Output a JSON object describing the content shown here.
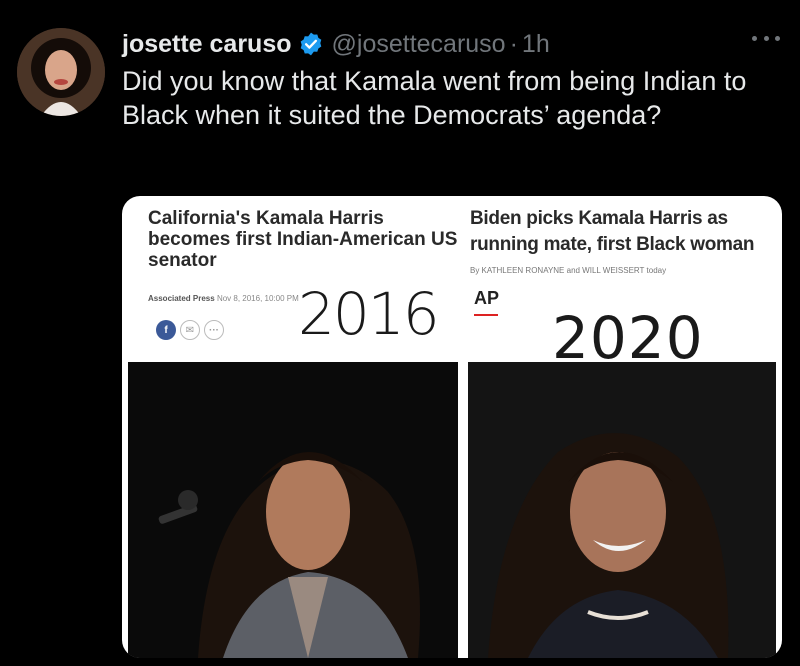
{
  "tweet": {
    "display_name": "josette caruso",
    "handle": "@josettecaruso",
    "separator": "·",
    "time": "1h",
    "text": "Did you know that Kamala went from being Indian to Black when it suited the Democrats’ agenda?"
  },
  "icons": {
    "verified": "verified-badge-icon",
    "more": "more-options-icon"
  },
  "media": {
    "left_headline": "California's Kamala Harris becomes first Indian-American US senator",
    "left_source": "Associated Press",
    "left_date": "Nov 8, 2016, 10:00 PM",
    "left_year": "2016",
    "right_headline": "Biden picks Kamala Harris as running mate, first Black woman",
    "right_byline": "By KATHLEEN RONAYNE and WILL WEISSERT",
    "right_byline_time": "today",
    "ap_label": "AP",
    "right_year": "2020"
  },
  "colors": {
    "background": "#000000",
    "primary_text": "#e7e9ea",
    "secondary_text": "#71767b",
    "verified_blue": "#1d9bf0"
  }
}
